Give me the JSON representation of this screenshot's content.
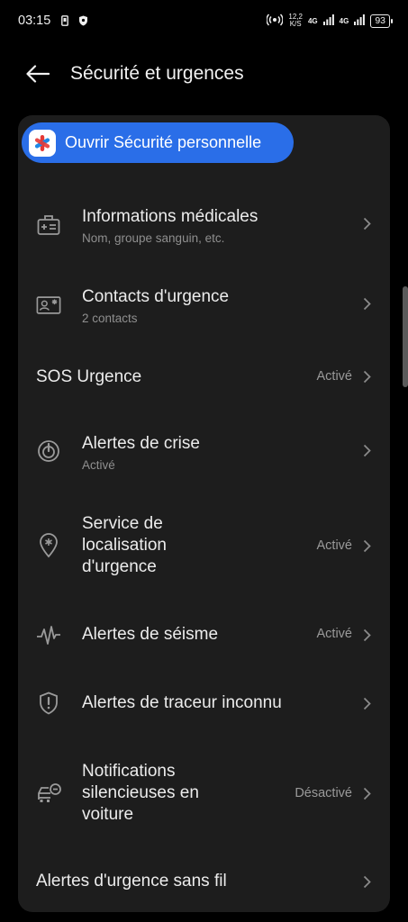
{
  "status_bar": {
    "time": "03:15",
    "net_speed_value": "12,2",
    "net_speed_unit": "K/S",
    "net_type_1": "4G",
    "net_type_2": "4G",
    "battery": "93"
  },
  "header": {
    "title": "Sécurité et urgences"
  },
  "cta": {
    "label": "Ouvrir Sécurité personnelle"
  },
  "items": [
    {
      "title": "Informations médicales",
      "subtitle": "Nom, groupe sanguin, etc.",
      "status": "",
      "icon": "medical-id-icon"
    },
    {
      "title": "Contacts d'urgence",
      "subtitle": "2 contacts",
      "status": "",
      "icon": "contact-card-icon"
    },
    {
      "title": "SOS Urgence",
      "subtitle": "",
      "status": "Activé",
      "icon": ""
    },
    {
      "title": "Alertes de crise",
      "subtitle": "Activé",
      "status": "",
      "icon": "crisis-alert-icon"
    },
    {
      "title_lines": [
        "Service de",
        "localisation",
        "d'urgence"
      ],
      "status": "Activé",
      "icon": "location-asterisk-icon"
    },
    {
      "title": "Alertes de séisme",
      "subtitle": "",
      "status": "Activé",
      "icon": "seismic-wave-icon"
    },
    {
      "title": "Alertes de traceur inconnu",
      "subtitle": "",
      "status": "",
      "icon": "shield-alert-icon"
    },
    {
      "title_lines": [
        "Notifications",
        "silencieuses en",
        "voiture"
      ],
      "status": "Désactivé",
      "icon": "car-mute-icon"
    },
    {
      "title": "Alertes d'urgence sans fil",
      "subtitle": "",
      "status": "",
      "icon": ""
    }
  ],
  "colors": {
    "background": "#000000",
    "card": "#1d1d1d",
    "accent": "#2a6ee8",
    "text_primary": "#ececec",
    "text_secondary": "#8f8f8f"
  }
}
